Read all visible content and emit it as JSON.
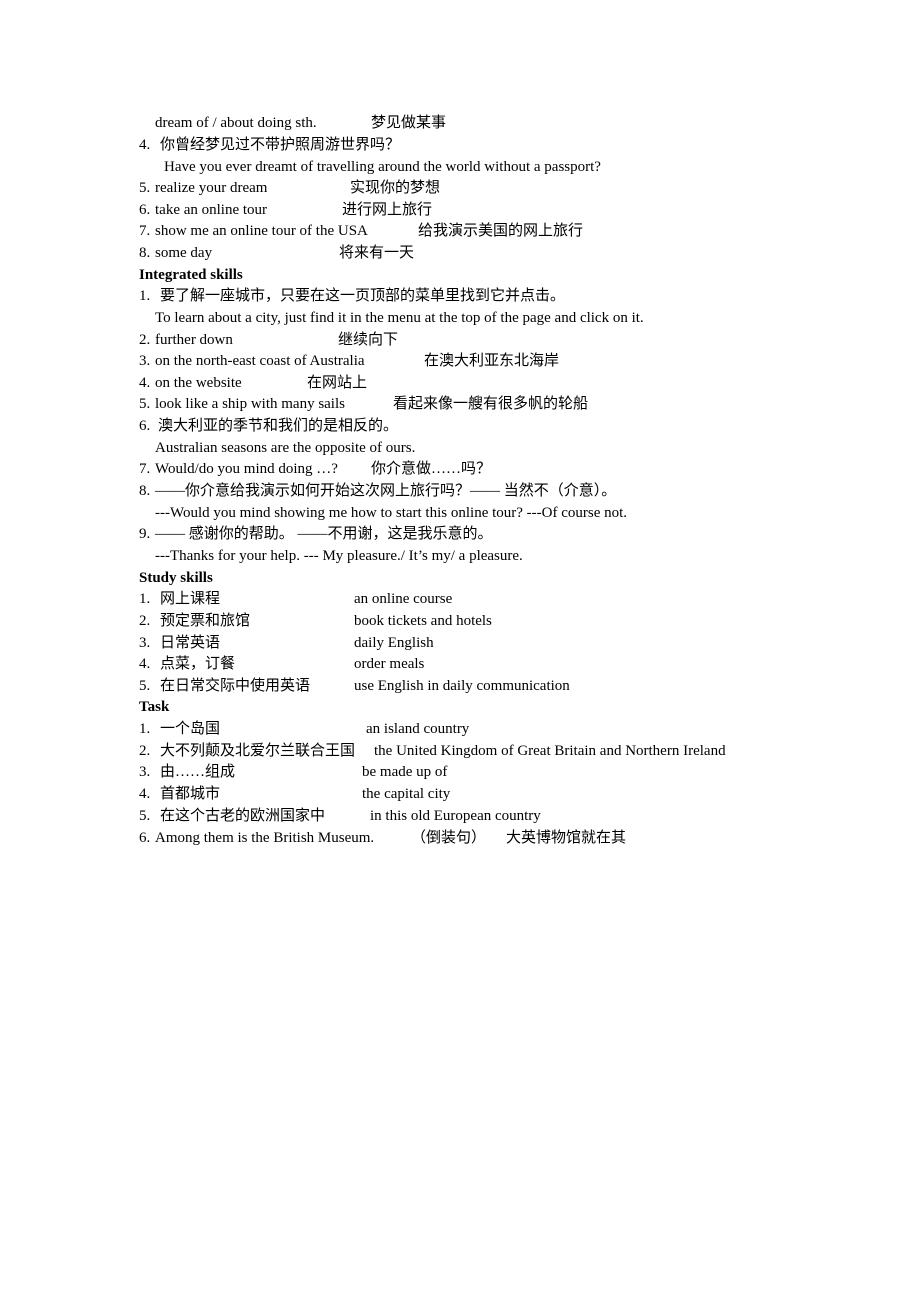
{
  "document": {
    "intro": {
      "phrase": "dream of / about doing sth.",
      "translation": "梦见做某事"
    },
    "vocab_items": [
      {
        "num": "4.",
        "text": "你曾经梦见过不带护照周游世界吗？",
        "sub": "Have you ever dreamt of travelling around the world without a passport?"
      },
      {
        "num": "5.",
        "phrase": "realize your dream",
        "translation": "实现你的梦想"
      },
      {
        "num": "6.",
        "phrase": "take an online tour",
        "translation": "进行网上旅行"
      },
      {
        "num": "7.",
        "phrase": "show me an online tour of the USA",
        "translation": "给我演示美国的网上旅行"
      },
      {
        "num": "8.",
        "phrase": "some day",
        "translation": "将来有一天"
      }
    ],
    "integrated_skills": {
      "heading": "Integrated skills",
      "items": [
        {
          "num": "1.",
          "text": "要了解一座城市，只要在这一页顶部的菜单里找到它并点击。",
          "sub": "To learn about a city, just find it in the menu at the top of the page and click on it."
        },
        {
          "num": "2.",
          "phrase": "further down",
          "translation": "继续向下"
        },
        {
          "num": "3.",
          "phrase": "on the north-east coast of Australia",
          "translation": "在澳大利亚东北海岸"
        },
        {
          "num": "4.",
          "phrase": "on the website",
          "translation": "在网站上"
        },
        {
          "num": "5.",
          "phrase": "look like a ship with many sails",
          "translation": "看起来像一艘有很多帆的轮船"
        },
        {
          "num": "6.",
          "text": "澳大利亚的季节和我们的是相反的。",
          "sub": "Australian seasons are the opposite of ours."
        },
        {
          "num": "7.",
          "phrase": "Would/do you mind doing …?",
          "translation": "你介意做……吗？"
        },
        {
          "num": "8.",
          "text": "——你介意给我演示如何开始这次网上旅行吗？——  当然不（介意）。",
          "sub": "---Would you mind showing me how to start this online tour? ---Of course not."
        },
        {
          "num": "9.",
          "text": "——  感谢你的帮助。 ——不用谢，这是我乐意的。",
          "sub": "---Thanks for your help. --- My pleasure./ It’s my/ a pleasure."
        }
      ]
    },
    "study_skills": {
      "heading": "Study skills",
      "items": [
        {
          "num": "1.",
          "chinese": "网上课程",
          "english": "an online course"
        },
        {
          "num": "2.",
          "chinese": "预定票和旅馆",
          "english": "book tickets and hotels"
        },
        {
          "num": "3.",
          "chinese": "日常英语",
          "english": "daily English"
        },
        {
          "num": "4.",
          "chinese": "点菜，订餐",
          "english": "order meals"
        },
        {
          "num": "5.",
          "chinese": "在日常交际中使用英语",
          "english": "use English in daily communication"
        }
      ]
    },
    "task": {
      "heading": "Task",
      "items": [
        {
          "num": "1.",
          "chinese": "一个岛国",
          "english": "an island country"
        },
        {
          "num": "2.",
          "chinese": "大不列颠及北爱尔兰联合王国",
          "english": "the United Kingdom of Great Britain and Northern Ireland"
        },
        {
          "num": "3.",
          "chinese": "由……组成",
          "english": "be made up of"
        },
        {
          "num": "4.",
          "chinese": "首都城市",
          "english": "the capital city"
        },
        {
          "num": "5.",
          "chinese": "在这个古老的欧洲国家中",
          "english": "in this old European country"
        },
        {
          "num": "6.",
          "phrase": "Among them is the British Museum.",
          "note": "（倒装句）",
          "translation": "大英博物馆就在其"
        }
      ]
    }
  }
}
